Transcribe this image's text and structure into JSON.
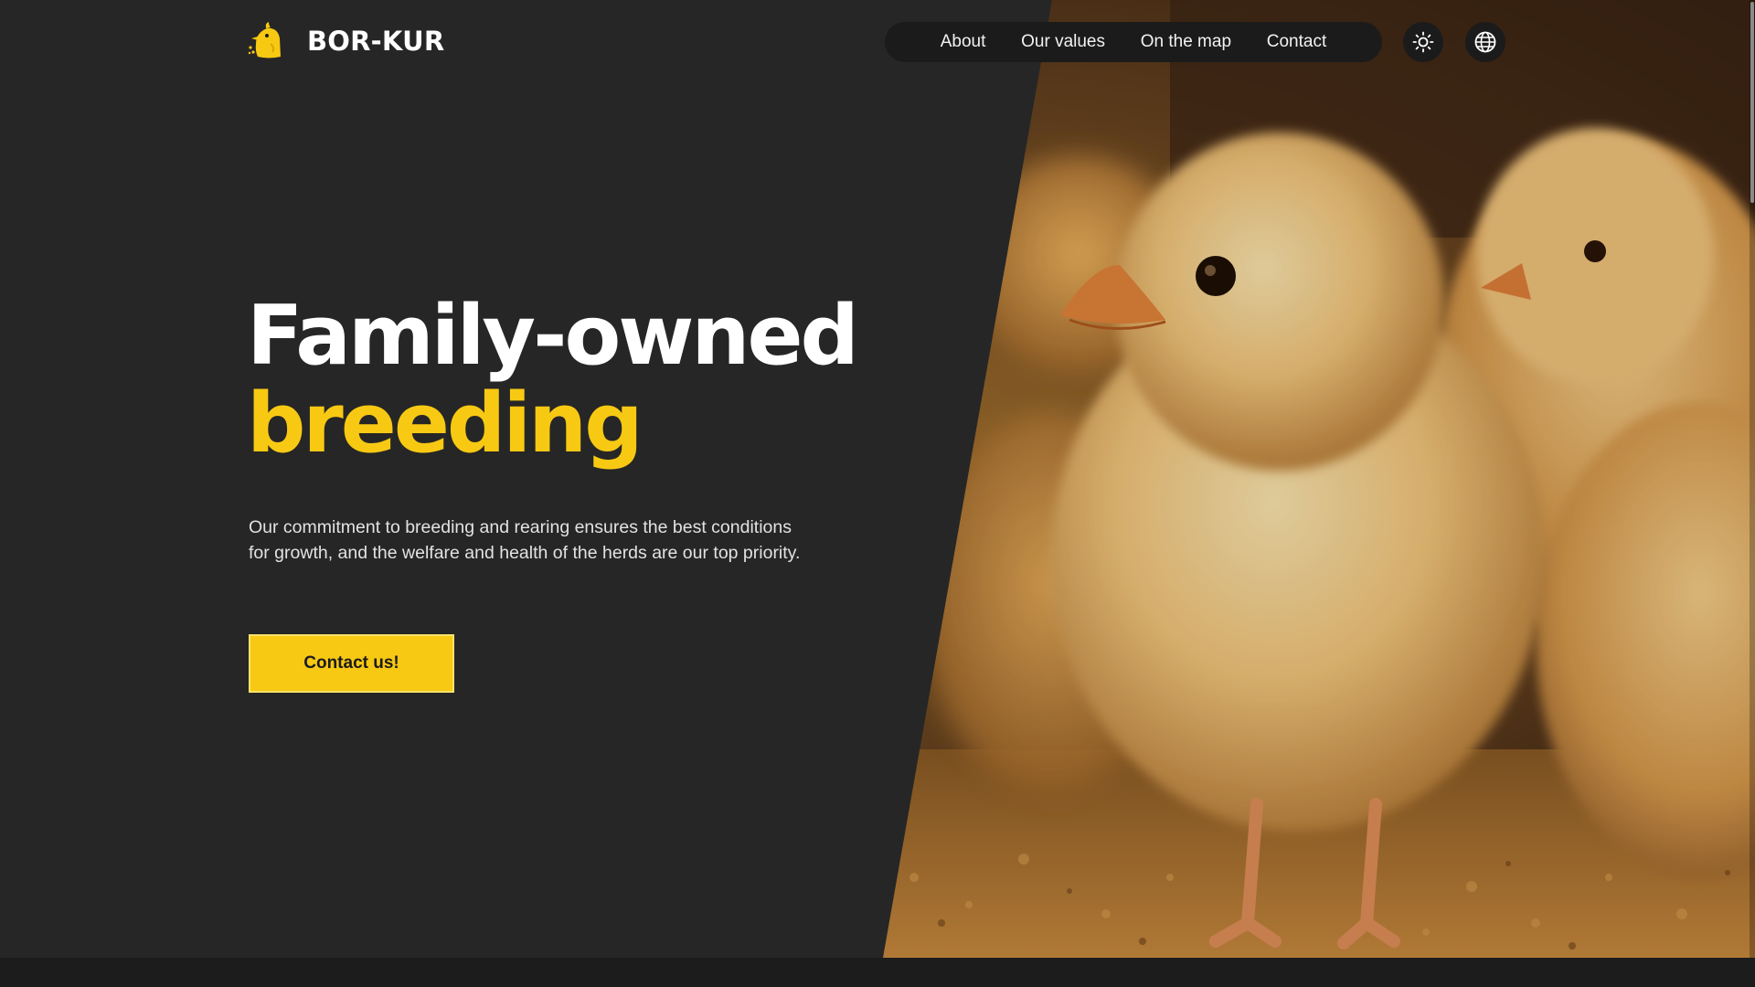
{
  "brand": {
    "name": "BOR-KUR",
    "logo_icon": "chick-logo-icon"
  },
  "nav": {
    "items": [
      {
        "label": "About"
      },
      {
        "label": "Our values"
      },
      {
        "label": "On the map"
      },
      {
        "label": "Contact"
      }
    ]
  },
  "toolbar": {
    "theme_icon": "sun-icon",
    "language_icon": "globe-icon"
  },
  "hero": {
    "title_line1": "Family-owned",
    "title_line2": "breeding",
    "description": "Our commitment to breeding and rearing ensures the best conditions for growth, and the welfare and health of the herds are our top priority.",
    "cta_label": "Contact us!",
    "image_subject": "yellow-chicks-photo"
  },
  "colors": {
    "background": "#262626",
    "accent": "#f8c913",
    "nav_background": "#1b1b1b",
    "text": "#ffffff"
  }
}
